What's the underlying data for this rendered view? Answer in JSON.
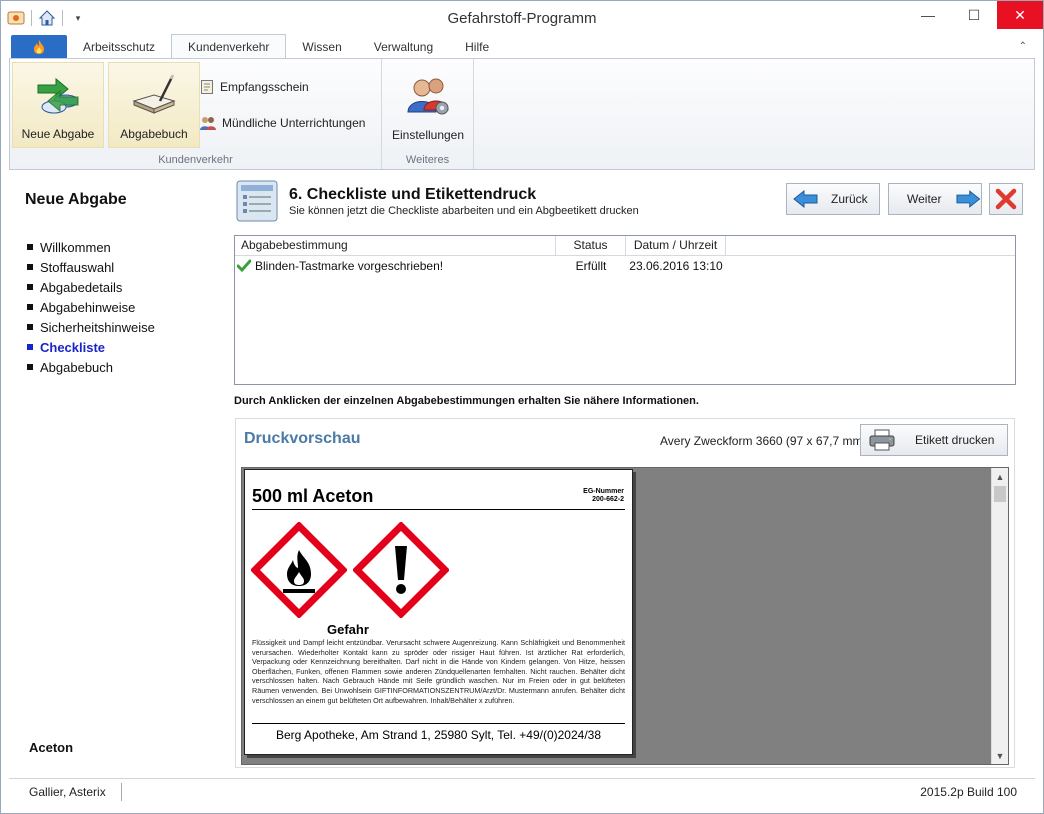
{
  "window": {
    "title": "Gefahrstoff-Programm"
  },
  "ribbon": {
    "tabs": [
      "Arbeitsschutz",
      "Kundenverkehr",
      "Wissen",
      "Verwaltung",
      "Hilfe"
    ],
    "active_tab": "Kundenverkehr",
    "groups": {
      "kundenverkehr": {
        "label": "Kundenverkehr",
        "neue_abgabe": "Neue Abgabe",
        "abgabebuch": "Abgabebuch",
        "empfangsschein": "Empfangsschein",
        "unterrichtungen": "Mündliche Unterrichtungen"
      },
      "weiteres": {
        "label": "Weiteres",
        "einstellungen": "Einstellungen"
      }
    }
  },
  "sidebar": {
    "title": "Neue Abgabe",
    "steps": [
      {
        "label": "Willkommen",
        "current": false
      },
      {
        "label": "Stoffauswahl",
        "current": false
      },
      {
        "label": "Abgabedetails",
        "current": false
      },
      {
        "label": "Abgabehinweise",
        "current": false
      },
      {
        "label": "Sicherheitshinweise",
        "current": false
      },
      {
        "label": "Checkliste",
        "current": true
      },
      {
        "label": "Abgabebuch",
        "current": false
      }
    ],
    "footer": "Aceton"
  },
  "main": {
    "step_title": "6. Checkliste und Etikettendruck",
    "step_subtitle": "Sie können jetzt die Checkliste abarbeiten und ein Abgbeetikett drucken",
    "back_button": "Zurück",
    "next_button": "Weiter",
    "table": {
      "columns": [
        "Abgabebestimmung",
        "Status",
        "Datum / Uhrzeit"
      ],
      "rows": [
        {
          "bestimmung": "Blinden-Tastmarke vorgeschrieben!",
          "status": "Erfüllt",
          "datum": "23.06.2016 13:10"
        }
      ]
    },
    "hint": "Durch Anklicken der einzelnen Abgabebestimmungen erhalten Sie nähere Informationen."
  },
  "preview": {
    "title": "Druckvorschau",
    "format": "Avery Zweckform 3660 (97 x 67,7 mm)",
    "print_button": "Etikett drucken",
    "label": {
      "product": "500 ml Aceton",
      "eg_label": "EG-Nummer",
      "eg_number": "200-662-2",
      "signal_word": "Gefahr",
      "hazard_text": "Flüssigkeit und Dampf leicht entzündbar. Verursacht schwere Augenreizung. Kann Schläfrigkeit und Benommenheit verursachen. Wiederholter Kontakt kann zu spröder oder rissiger Haut führen. Ist ärztlicher Rat erforderlich, Verpackung oder Kennzeichnung bereithalten. Darf nicht in die Hände von Kindern gelangen. Von Hitze, heissen Oberflächen, Funken, offenen Flammen sowie anderen Zündquellenarten fernhalten. Nicht rauchen. Behälter dicht verschlossen halten. Nach Gebrauch Hände mit Seife gründlich waschen. Nur im Freien oder in gut belüfteten Räumen verwenden. Bei Unwohlsein GIFTINFORMATIONSZENTRUM/Arzt/Dr. Mustermann anrufen. Behälter dicht verschlossen an einem gut belüfteten Ort aufbewahren. Inhalt/Behälter x zuführen.",
      "address": "Berg Apotheke, Am Strand 1, 25980 Sylt, Tel. +49/(0)2024/38"
    }
  },
  "statusbar": {
    "user": "Gallier, Asterix",
    "build": "2015.2p Build 100"
  },
  "colors": {
    "accent_blue": "#2b6cc4",
    "ghs_red": "#e2001a",
    "current_step": "#1a25c8",
    "preview_title": "#4a7aa6"
  }
}
